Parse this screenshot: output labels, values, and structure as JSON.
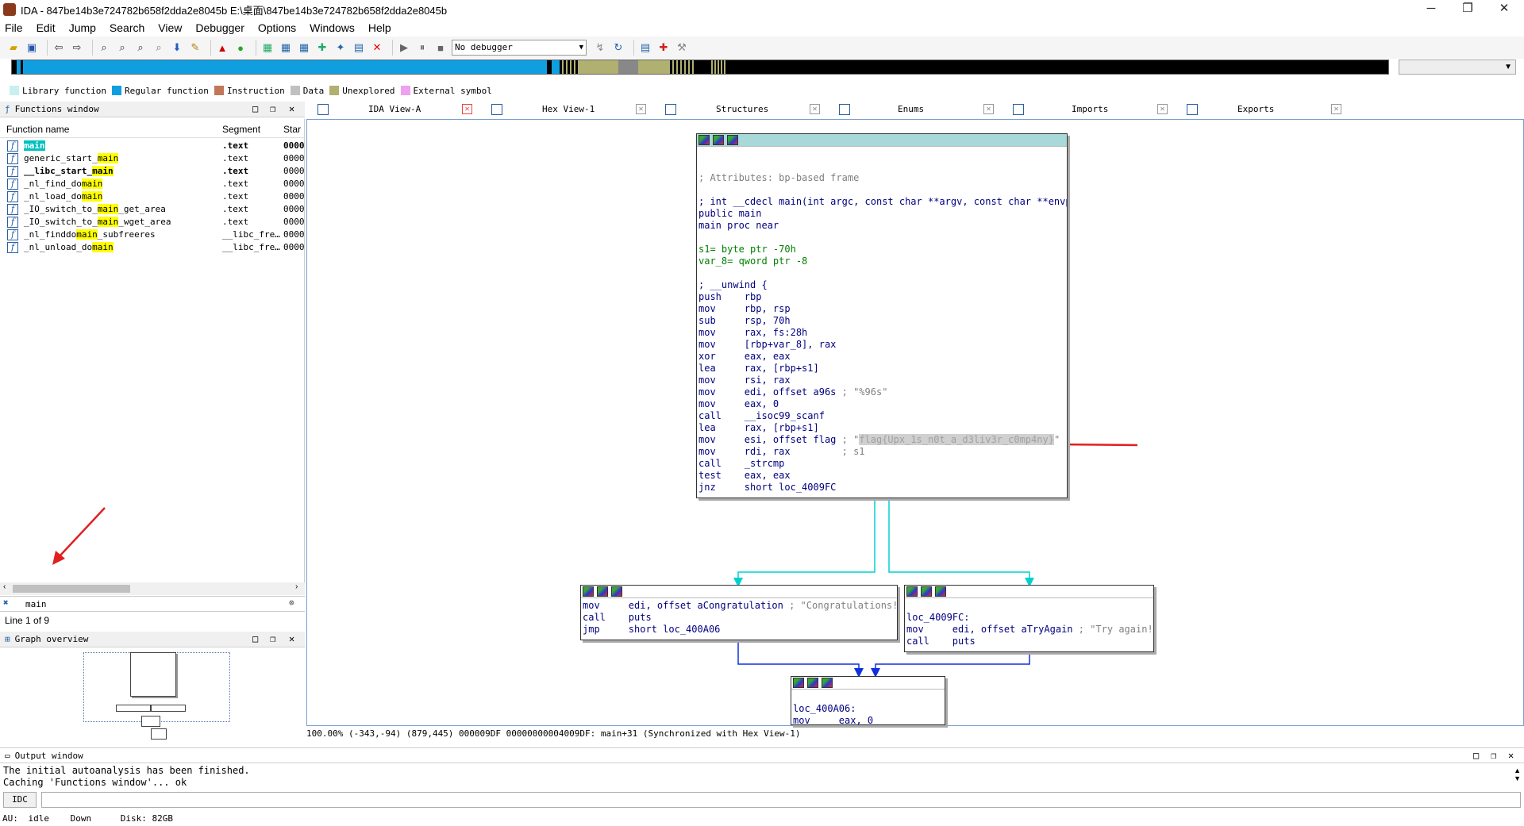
{
  "window": {
    "title": "IDA - 847be14b3e724782b658f2dda2e8045b E:\\桌面\\847be14b3e724782b658f2dda2e8045b"
  },
  "menu": [
    "File",
    "Edit",
    "Jump",
    "Search",
    "View",
    "Debugger",
    "Options",
    "Windows",
    "Help"
  ],
  "toolbar": {
    "debugger_select": "No debugger"
  },
  "legend": [
    {
      "label": "Library function",
      "color": "#c8f0f0"
    },
    {
      "label": "Regular function",
      "color": "#0f9fe0"
    },
    {
      "label": "Instruction",
      "color": "#c07858"
    },
    {
      "label": "Data",
      "color": "#c0c0c0"
    },
    {
      "label": "Unexplored",
      "color": "#b0b070"
    },
    {
      "label": "External symbol",
      "color": "#f0a0f0"
    }
  ],
  "functions_window": {
    "title": "Functions window",
    "columns": [
      "Function name",
      "Segment",
      "Star"
    ],
    "rows": [
      {
        "pre": "",
        "hl": "main",
        "post": "",
        "seg": ".text",
        "start": "0000",
        "bold": true,
        "current": true
      },
      {
        "pre": "generic_start_",
        "hl": "main",
        "post": "",
        "seg": ".text",
        "start": "0000",
        "bold": false
      },
      {
        "pre": "__libc_start_",
        "hl": "main",
        "post": "",
        "seg": ".text",
        "start": "0000",
        "bold": true
      },
      {
        "pre": "_nl_find_do",
        "hl": "main",
        "post": "",
        "seg": ".text",
        "start": "0000",
        "bold": false
      },
      {
        "pre": "_nl_load_do",
        "hl": "main",
        "post": "",
        "seg": ".text",
        "start": "0000",
        "bold": false
      },
      {
        "pre": "_IO_switch_to_",
        "hl": "main",
        "post": "_get_area",
        "seg": ".text",
        "start": "0000",
        "bold": false
      },
      {
        "pre": "_IO_switch_to_",
        "hl": "main",
        "post": "_wget_area",
        "seg": ".text",
        "start": "0000",
        "bold": false
      },
      {
        "pre": "_nl_finddo",
        "hl": "main",
        "post": "_subfreeres",
        "seg": "__libc_fre…",
        "start": "0000",
        "bold": false
      },
      {
        "pre": "_nl_unload_do",
        "hl": "main",
        "post": "",
        "seg": "__libc_fre…",
        "start": "0000",
        "bold": false
      }
    ],
    "search_value": "main",
    "status": "Line 1 of 9"
  },
  "graph_overview": {
    "title": "Graph overview"
  },
  "tabs": [
    {
      "label": "IDA View-A",
      "active": true
    },
    {
      "label": "Hex View-1",
      "active": false
    },
    {
      "label": "Structures",
      "active": false
    },
    {
      "label": "Enums",
      "active": false
    },
    {
      "label": "Imports",
      "active": false
    },
    {
      "label": "Exports",
      "active": false
    }
  ],
  "main_block": {
    "attr": "; Attributes: bp-based frame",
    "proto": "; int __cdecl main(int argc, const char **argv, const char **envp)",
    "public": "public main",
    "proc": "main proc near",
    "s1": "s1= byte ptr -70h",
    "var8": "var_8= qword ptr -8",
    "unwind": "; __unwind {",
    "asm": [
      [
        "push",
        "rbp",
        ""
      ],
      [
        "mov",
        "rbp, rsp",
        ""
      ],
      [
        "sub",
        "rsp, 70h",
        ""
      ],
      [
        "mov",
        "rax, fs:28h",
        ""
      ],
      [
        "mov",
        "[rbp+var_8], rax",
        ""
      ],
      [
        "xor",
        "eax, eax",
        ""
      ],
      [
        "lea",
        "rax, [rbp+s1]",
        ""
      ],
      [
        "mov",
        "rsi, rax",
        ""
      ],
      [
        "mov",
        "edi, offset a96s",
        "; \"%96s\""
      ],
      [
        "mov",
        "eax, 0",
        ""
      ],
      [
        "call",
        "__isoc99_scanf",
        ""
      ],
      [
        "lea",
        "rax, [rbp+s1]",
        ""
      ]
    ],
    "flag_line": {
      "mn": "mov",
      "op": "esi, offset flag",
      "cm_pre": "; \"",
      "flag": "flag{Upx_1s_n0t_a_d3liv3r_c0mp4ny}",
      "cm_post": "\""
    },
    "asm2": [
      [
        "mov",
        "rdi, rax",
        "        ; s1"
      ],
      [
        "call",
        "_strcmp",
        ""
      ],
      [
        "test",
        "eax, eax",
        ""
      ],
      [
        "jnz",
        "short loc_4009FC",
        ""
      ]
    ]
  },
  "block_left": {
    "asm": [
      [
        "mov",
        "edi, offset aCongratulation",
        "; \"Congratulations!\""
      ],
      [
        "call",
        "puts",
        ""
      ],
      [
        "jmp",
        "short loc_400A06",
        ""
      ]
    ]
  },
  "block_right": {
    "label": "loc_4009FC:",
    "asm": [
      [
        "mov",
        "edi, offset aTryAgain",
        "; \"Try again!\""
      ],
      [
        "call",
        "puts",
        ""
      ]
    ]
  },
  "block_bottom": {
    "label": "loc_400A06:",
    "asm": [
      [
        "mov",
        "eax, 0",
        ""
      ]
    ]
  },
  "graph_status": "100.00% (-343,-94) (879,445) 000009DF 00000000004009DF: main+31 (Synchronized with Hex View-1)",
  "output": {
    "title": "Output window",
    "lines": "The initial autoanalysis has been finished.\nCaching 'Functions window'... ok",
    "idc": "IDC"
  },
  "statusbar": {
    "au": "AU:",
    "state": "idle",
    "dir": "Down",
    "disk": "Disk: 82GB"
  }
}
